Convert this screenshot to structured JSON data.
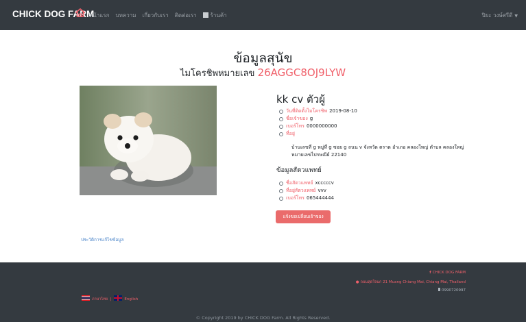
{
  "navbar": {
    "brand": "CHICK DOG FARM",
    "links": [
      "หน้าแรก",
      "บทความ",
      "เกี่ยวกับเรา",
      "ติดต่อเรา"
    ],
    "shop_label": "ร้านค้า",
    "user_label": "ปิยะ วงษ์ศรีดี"
  },
  "header": {
    "title": "ข้อมูลสุนัข",
    "subtitle_label": "ไมโครชิพหมายเลข",
    "chip_number": "26AGGC8OJ9LYW"
  },
  "dog": {
    "name": "kk cv ตัวผู้",
    "fields": [
      {
        "label": "วันที่ติดตั้งไมโครชิพ",
        "value": "2019-08-10"
      },
      {
        "label": "ชื่อเจ้าของ",
        "value": "g"
      },
      {
        "label": "เบอร์โทร",
        "value": "0000000000"
      },
      {
        "label": "ที่อยู่",
        "value": ""
      }
    ],
    "address": "บ้านเลขที่ g หมู่ที่ g ซอย g ถนน v จังหวัด ตราด อำเภอ คลองใหญ่ ตำบล คลองใหญ่ หมายเลขไปรษณีย์ 22140"
  },
  "vet": {
    "heading": "ข้อมูลสัตวแพทย์",
    "fields": [
      {
        "label": "ชื่อสัตวแพทย์",
        "value": "xcccccv"
      },
      {
        "label": "ที่อยู่สัตวแพทย์",
        "value": "vvv"
      },
      {
        "label": "เบอร์โทร",
        "value": "065444444"
      }
    ]
  },
  "actions": {
    "request_change": "แจ้งขอเปลี่ยนเจ้าของ",
    "edit_history": "ประวัติการแก้ไขข้อมูล"
  },
  "footer": {
    "social": "CHICK DOG FARM",
    "address": "ถนนสุดใจนก 21 Muang Chiang Mai, Chiang Mai, Thailand",
    "phone": "0990720997",
    "lang_thai": "ภาษาไทย",
    "lang_sep": "|",
    "lang_english": "English",
    "copyright": "© Copyright 2019 by CHICK DOG Farm. All Rights Reserved."
  },
  "colors": {
    "accent": "#f0606a",
    "navbar": "#343a40",
    "button": "#ea6b6b"
  }
}
